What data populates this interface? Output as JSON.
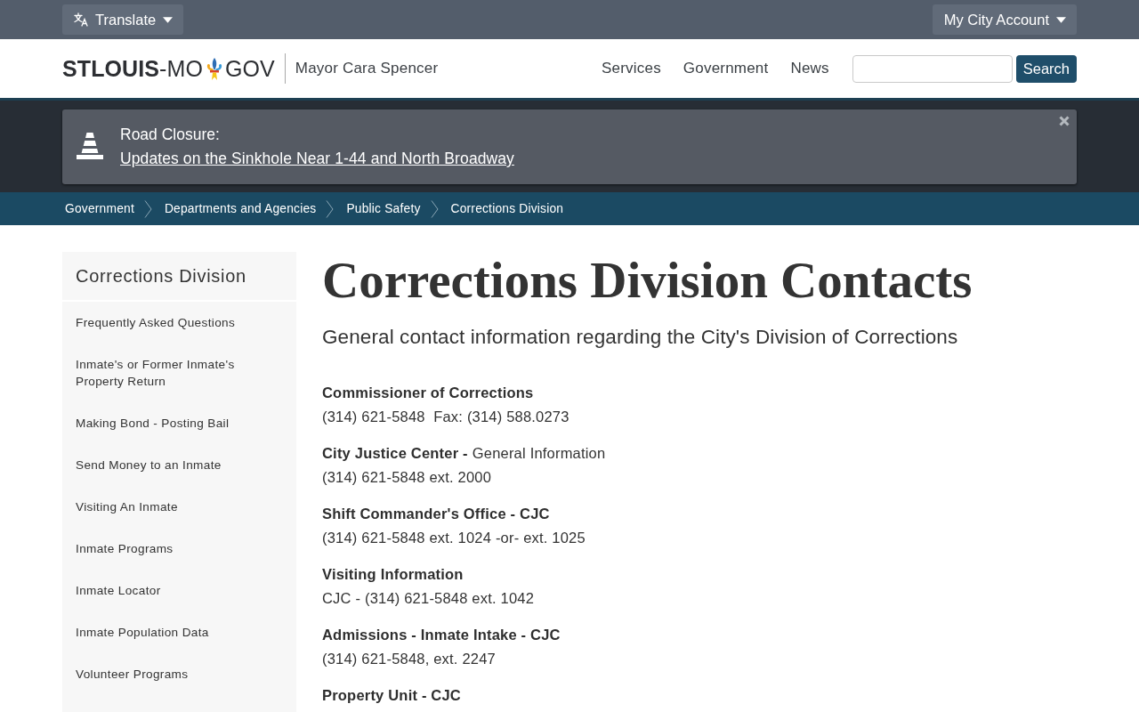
{
  "top_bar": {
    "translate": "Translate",
    "account": "My City Account"
  },
  "header": {
    "logo_before": "**STLOUIS**-MO",
    "logo_after": "GOV",
    "mayor": "Mayor Cara Spencer",
    "nav": [
      "Services",
      "Government",
      "News"
    ],
    "search_button": "Search"
  },
  "alert": {
    "label": "Road Closure:",
    "link": "Updates on the Sinkhole Near 1-44 and North Broadway"
  },
  "breadcrumb": [
    "Government",
    "Departments and Agencies",
    "Public Safety",
    "Corrections Division"
  ],
  "sidebar": {
    "title": "Corrections Division",
    "items": [
      "Frequently Asked Questions",
      "Inmate's or Former Inmate's Property Return",
      "Making Bond - Posting Bail",
      "Send Money to an Inmate",
      "Visiting An Inmate",
      "Inmate Programs",
      "Inmate Locator",
      "Inmate Population Data",
      "Volunteer Programs"
    ]
  },
  "content": {
    "title": "Corrections Division Contacts",
    "subtitle": "General contact information regarding the City's Division of Corrections",
    "contacts": [
      {
        "title": "Commissioner of Corrections",
        "detail": "(314) 621-5848  Fax: (314) 588.0273"
      },
      {
        "title": "City Justice Center -",
        "note": "General Information",
        "detail": "(314) 621-5848 ext. 2000"
      },
      {
        "title": "Shift Commander's Office - CJC",
        "detail": "(314) 621-5848 ext. 1024 -or- ext. 1025"
      },
      {
        "title": "Visiting Information",
        "detail": "CJC - (314) 621-5848 ext. 1042"
      },
      {
        "title": "Admissions - Inmate Intake - CJC",
        "detail": "(314) 621-5848, ext. 2247"
      },
      {
        "title": "Property Unit - CJC"
      }
    ]
  }
}
